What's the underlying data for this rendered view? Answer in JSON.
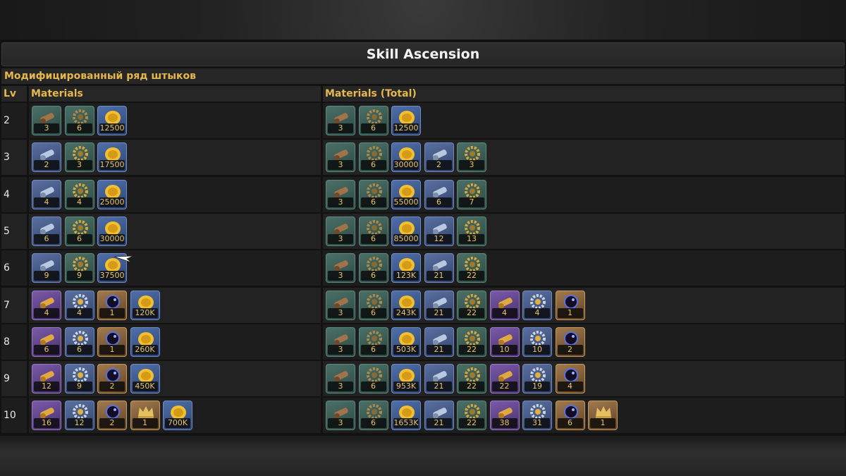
{
  "title": "Skill Ascension",
  "subtitle": "Модифицированный ряд штыков",
  "headers": {
    "lv": "Lv",
    "materials": "Materials",
    "total": "Materials (Total)"
  },
  "colors": {
    "accent": "#e6b84c",
    "title_text": "#f2f2f2"
  },
  "rows": [
    {
      "lv": "2",
      "materials": [
        {
          "icon": "copper-cannon-icon",
          "tier": "green",
          "count": "3"
        },
        {
          "icon": "gear-icon",
          "tier": "green",
          "count": "6"
        },
        {
          "icon": "gold-coin-icon",
          "tier": "coin",
          "count": "12500"
        }
      ],
      "total": [
        {
          "icon": "copper-cannon-icon",
          "tier": "green",
          "count": "3"
        },
        {
          "icon": "gear-icon",
          "tier": "green",
          "count": "6"
        },
        {
          "icon": "gold-coin-icon",
          "tier": "coin",
          "count": "12500"
        }
      ]
    },
    {
      "lv": "3",
      "materials": [
        {
          "icon": "steel-cannon-icon",
          "tier": "blue",
          "count": "2"
        },
        {
          "icon": "gold-gear-icon",
          "tier": "green",
          "count": "3"
        },
        {
          "icon": "gold-coin-icon",
          "tier": "coin",
          "count": "17500"
        }
      ],
      "total": [
        {
          "icon": "copper-cannon-icon",
          "tier": "green",
          "count": "3"
        },
        {
          "icon": "gear-icon",
          "tier": "green",
          "count": "6"
        },
        {
          "icon": "gold-coin-icon",
          "tier": "coin",
          "count": "30000"
        },
        {
          "icon": "steel-cannon-icon",
          "tier": "blue",
          "count": "2"
        },
        {
          "icon": "gold-gear-icon",
          "tier": "green",
          "count": "3"
        }
      ]
    },
    {
      "lv": "4",
      "materials": [
        {
          "icon": "steel-cannon-icon",
          "tier": "blue",
          "count": "4"
        },
        {
          "icon": "gold-gear-icon",
          "tier": "green",
          "count": "4"
        },
        {
          "icon": "gold-coin-icon",
          "tier": "coin",
          "count": "25000"
        }
      ],
      "total": [
        {
          "icon": "copper-cannon-icon",
          "tier": "green",
          "count": "3"
        },
        {
          "icon": "gear-icon",
          "tier": "green",
          "count": "6"
        },
        {
          "icon": "gold-coin-icon",
          "tier": "coin",
          "count": "55000"
        },
        {
          "icon": "steel-cannon-icon",
          "tier": "blue",
          "count": "6"
        },
        {
          "icon": "gold-gear-icon",
          "tier": "green",
          "count": "7"
        }
      ]
    },
    {
      "lv": "5",
      "materials": [
        {
          "icon": "steel-cannon-icon",
          "tier": "blue",
          "count": "6"
        },
        {
          "icon": "gold-gear-icon",
          "tier": "green",
          "count": "6"
        },
        {
          "icon": "gold-coin-icon",
          "tier": "coin",
          "count": "30000"
        }
      ],
      "total": [
        {
          "icon": "copper-cannon-icon",
          "tier": "green",
          "count": "3"
        },
        {
          "icon": "gear-icon",
          "tier": "green",
          "count": "6"
        },
        {
          "icon": "gold-coin-icon",
          "tier": "coin",
          "count": "85000"
        },
        {
          "icon": "steel-cannon-icon",
          "tier": "blue",
          "count": "12"
        },
        {
          "icon": "gold-gear-icon",
          "tier": "green",
          "count": "13"
        }
      ]
    },
    {
      "lv": "6",
      "materials": [
        {
          "icon": "steel-cannon-icon",
          "tier": "blue",
          "count": "9"
        },
        {
          "icon": "gold-gear-icon",
          "tier": "green",
          "count": "9"
        },
        {
          "icon": "gold-coin-icon",
          "tier": "coin",
          "count": "37500"
        }
      ],
      "total": [
        {
          "icon": "copper-cannon-icon",
          "tier": "green",
          "count": "3"
        },
        {
          "icon": "gear-icon",
          "tier": "green",
          "count": "6"
        },
        {
          "icon": "gold-coin-icon",
          "tier": "coin",
          "count": "123K"
        },
        {
          "icon": "steel-cannon-icon",
          "tier": "blue",
          "count": "21"
        },
        {
          "icon": "gold-gear-icon",
          "tier": "green",
          "count": "22"
        }
      ]
    },
    {
      "lv": "7",
      "materials": [
        {
          "icon": "golden-cannon-icon",
          "tier": "purple",
          "count": "4"
        },
        {
          "icon": "silver-gear-icon",
          "tier": "blue",
          "count": "4"
        },
        {
          "icon": "dark-orb-icon",
          "tier": "gold",
          "count": "1"
        },
        {
          "icon": "gold-coin-icon",
          "tier": "coin",
          "count": "120K"
        }
      ],
      "total": [
        {
          "icon": "copper-cannon-icon",
          "tier": "green",
          "count": "3"
        },
        {
          "icon": "gear-icon",
          "tier": "green",
          "count": "6"
        },
        {
          "icon": "gold-coin-icon",
          "tier": "coin",
          "count": "243K"
        },
        {
          "icon": "steel-cannon-icon",
          "tier": "blue",
          "count": "21"
        },
        {
          "icon": "gold-gear-icon",
          "tier": "green",
          "count": "22"
        },
        {
          "icon": "golden-cannon-icon",
          "tier": "purple",
          "count": "4"
        },
        {
          "icon": "silver-gear-icon",
          "tier": "blue",
          "count": "4"
        },
        {
          "icon": "dark-orb-icon",
          "tier": "gold",
          "count": "1"
        }
      ]
    },
    {
      "lv": "8",
      "materials": [
        {
          "icon": "golden-cannon-icon",
          "tier": "purple",
          "count": "6"
        },
        {
          "icon": "silver-gear-icon",
          "tier": "blue",
          "count": "6"
        },
        {
          "icon": "dark-orb-icon",
          "tier": "gold",
          "count": "1"
        },
        {
          "icon": "gold-coin-icon",
          "tier": "coin",
          "count": "260K"
        }
      ],
      "total": [
        {
          "icon": "copper-cannon-icon",
          "tier": "green",
          "count": "3"
        },
        {
          "icon": "gear-icon",
          "tier": "green",
          "count": "6"
        },
        {
          "icon": "gold-coin-icon",
          "tier": "coin",
          "count": "503K"
        },
        {
          "icon": "steel-cannon-icon",
          "tier": "blue",
          "count": "21"
        },
        {
          "icon": "gold-gear-icon",
          "tier": "green",
          "count": "22"
        },
        {
          "icon": "golden-cannon-icon",
          "tier": "purple",
          "count": "10"
        },
        {
          "icon": "silver-gear-icon",
          "tier": "blue",
          "count": "10"
        },
        {
          "icon": "dark-orb-icon",
          "tier": "gold",
          "count": "2"
        }
      ]
    },
    {
      "lv": "9",
      "materials": [
        {
          "icon": "golden-cannon-icon",
          "tier": "purple",
          "count": "12"
        },
        {
          "icon": "silver-gear-icon",
          "tier": "blue",
          "count": "9"
        },
        {
          "icon": "dark-orb-icon",
          "tier": "gold",
          "count": "2"
        },
        {
          "icon": "gold-coin-icon",
          "tier": "coin",
          "count": "450K"
        }
      ],
      "total": [
        {
          "icon": "copper-cannon-icon",
          "tier": "green",
          "count": "3"
        },
        {
          "icon": "gear-icon",
          "tier": "green",
          "count": "6"
        },
        {
          "icon": "gold-coin-icon",
          "tier": "coin",
          "count": "953K"
        },
        {
          "icon": "steel-cannon-icon",
          "tier": "blue",
          "count": "21"
        },
        {
          "icon": "gold-gear-icon",
          "tier": "green",
          "count": "22"
        },
        {
          "icon": "golden-cannon-icon",
          "tier": "purple",
          "count": "22"
        },
        {
          "icon": "silver-gear-icon",
          "tier": "blue",
          "count": "19"
        },
        {
          "icon": "dark-orb-icon",
          "tier": "gold",
          "count": "4"
        }
      ]
    },
    {
      "lv": "10",
      "materials": [
        {
          "icon": "golden-cannon-icon",
          "tier": "purple",
          "count": "16"
        },
        {
          "icon": "silver-gear-icon",
          "tier": "blue",
          "count": "12"
        },
        {
          "icon": "dark-orb-icon",
          "tier": "gold",
          "count": "2"
        },
        {
          "icon": "crown-icon",
          "tier": "gold",
          "count": "1"
        },
        {
          "icon": "gold-coin-icon",
          "tier": "coin",
          "count": "700K"
        }
      ],
      "total": [
        {
          "icon": "copper-cannon-icon",
          "tier": "green",
          "count": "3"
        },
        {
          "icon": "gear-icon",
          "tier": "green",
          "count": "6"
        },
        {
          "icon": "gold-coin-icon",
          "tier": "coin",
          "count": "1653K"
        },
        {
          "icon": "steel-cannon-icon",
          "tier": "blue",
          "count": "21"
        },
        {
          "icon": "gold-gear-icon",
          "tier": "green",
          "count": "22"
        },
        {
          "icon": "golden-cannon-icon",
          "tier": "purple",
          "count": "38"
        },
        {
          "icon": "silver-gear-icon",
          "tier": "blue",
          "count": "31"
        },
        {
          "icon": "dark-orb-icon",
          "tier": "gold",
          "count": "6"
        },
        {
          "icon": "crown-icon",
          "tier": "gold",
          "count": "1"
        }
      ]
    }
  ]
}
